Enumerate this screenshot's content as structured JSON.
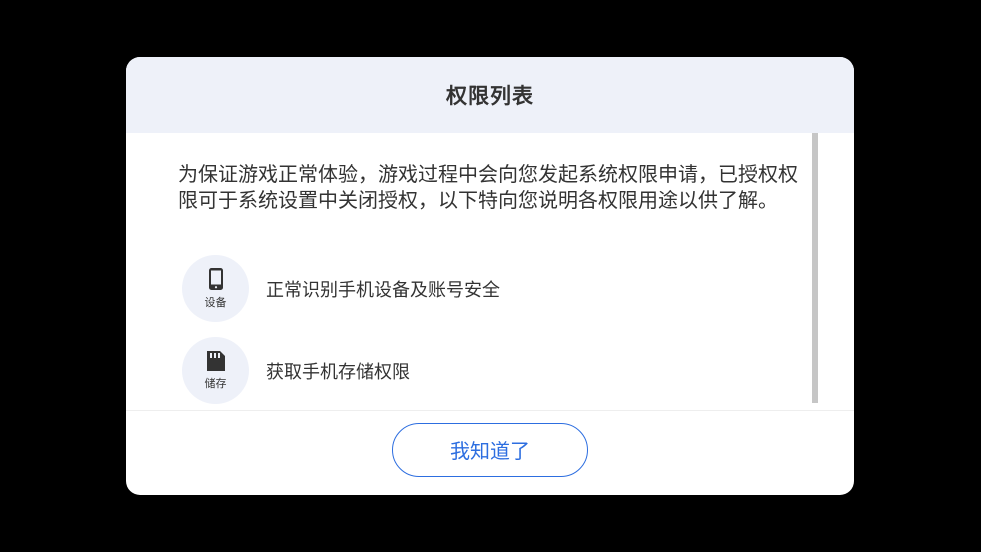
{
  "dialog": {
    "title": "权限列表",
    "description": "为保证游戏正常体验，游戏过程中会向您发起系统权限申请，已授权权限可于系统设置中关闭授权，以下特向您说明各权限用途以供了解。",
    "permissions": [
      {
        "icon": "phone-icon",
        "icon_label": "设备",
        "text": "正常识别手机设备及账号安全"
      },
      {
        "icon": "sd-card-icon",
        "icon_label": "储存",
        "text": "获取手机存储权限"
      }
    ],
    "confirm_label": "我知道了"
  },
  "colors": {
    "header_bg": "#eef1f9",
    "accent": "#2d6ee0",
    "text": "#333333",
    "overlay": "#000000"
  }
}
